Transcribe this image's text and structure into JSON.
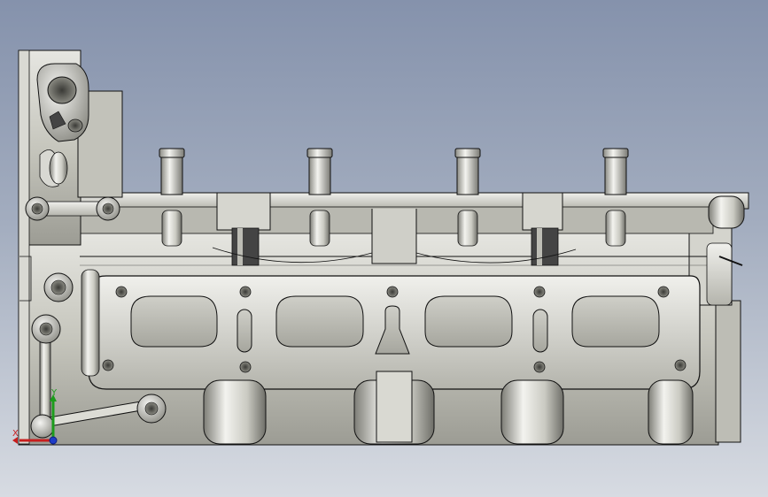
{
  "viewport": {
    "background_top": "#8592ac",
    "background_bottom": "#d7dbe2"
  },
  "model": {
    "part": "cylinder-head",
    "view": "side",
    "shade": "#c9c9c0",
    "shade_dark": "#8e8e86",
    "shade_light": "#ededea",
    "edge": "#111111"
  },
  "triad": {
    "x_label": "X",
    "y_label": "Y",
    "x_color": "#c81e1e",
    "y_color": "#1b9c1b",
    "z_color": "#1e3cc8"
  }
}
